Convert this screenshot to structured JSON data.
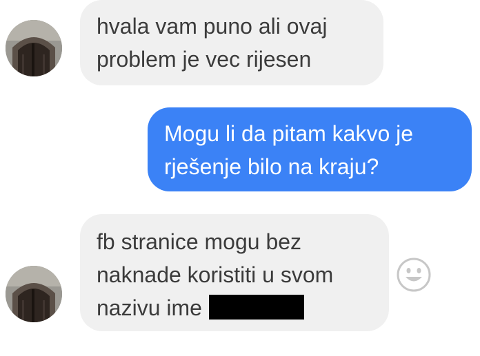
{
  "messages": [
    {
      "from": "other",
      "lines": [
        "hvala vam puno ali ovaj",
        "problem je vec rijesen"
      ]
    },
    {
      "from": "me",
      "lines": [
        "Mogu li da pitam kakvo je",
        "rješenje bilo na kraju?"
      ]
    },
    {
      "from": "other",
      "lines": [
        "fb stranice mogu bez",
        "naknade koristiti u svom",
        "nazivu ime"
      ],
      "redacted_tail": true
    }
  ],
  "reaction_icon": "smiley-face-icon",
  "colors": {
    "incoming_bubble": "#f0f0f0",
    "outgoing_bubble": "#3b82f6",
    "incoming_text": "#3b3b3b",
    "outgoing_text": "#ffffff"
  }
}
